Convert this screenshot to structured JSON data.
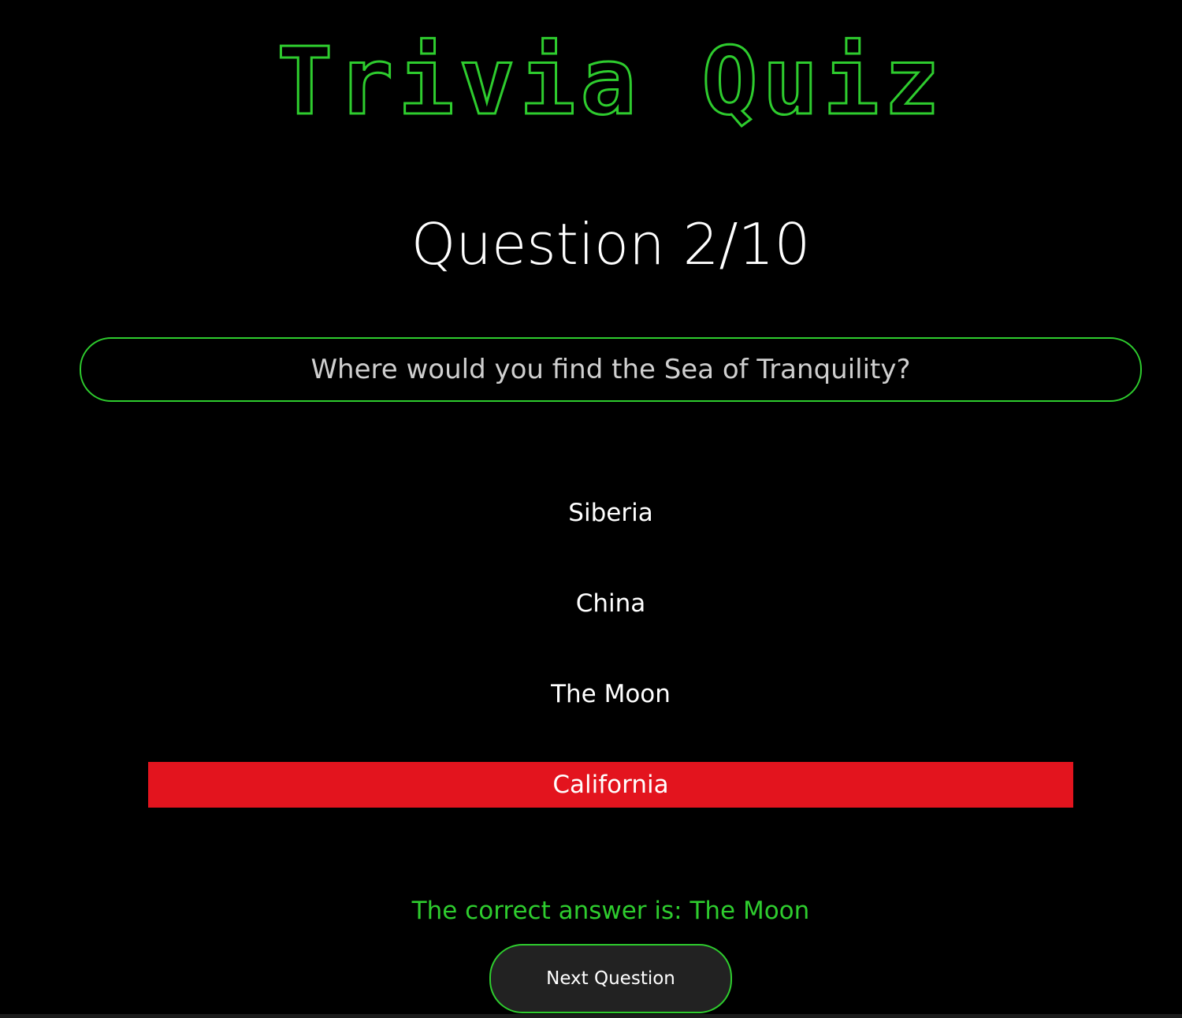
{
  "app": {
    "title": "Trivia Quiz"
  },
  "quiz": {
    "counter": "Question 2/10",
    "question": "Where would you find the Sea of Tranquility?",
    "answers": [
      {
        "label": "Siberia",
        "state": "neutral"
      },
      {
        "label": "China",
        "state": "neutral"
      },
      {
        "label": "The Moon",
        "state": "neutral"
      },
      {
        "label": "California",
        "state": "wrong"
      }
    ],
    "feedback": "The correct answer is: The Moon",
    "next_label": "Next Question"
  },
  "colors": {
    "background": "#000000",
    "accent": "#2ecc2e",
    "wrong": "#e3141e",
    "button_bg": "#222222"
  }
}
